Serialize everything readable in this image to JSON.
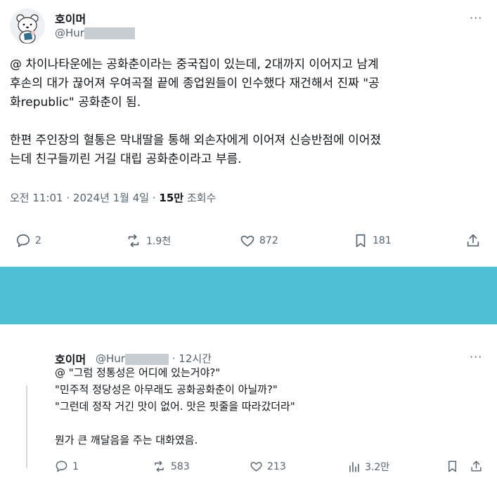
{
  "tweet1": {
    "author_name": "호이머",
    "handle_prefix": "@Hur",
    "more_label": "···",
    "text_lines": [
      "@ 차이나타운에는 공화춘이라는 중국집이 있는데, 2대까지 이어지고 남계",
      "후손의 대가 끊어져 우여곡절 끝에 종업원들이 인수했다 재건해서 진짜 \"공",
      "화republic\" 공화춘이 됨."
    ],
    "text_lines_2": [
      "한편 주인장의 혈통은 막내딸을 통해 외손자에게 이어져 신승반점에 이어졌",
      "는데 친구들끼린 거길 대립 공화춘이라고 부름."
    ],
    "meta_time": "오전 11:01 · 2024년 1월 4일 · ",
    "meta_views_count": "15만",
    "meta_views_label": " 조회수",
    "actions": {
      "replies": "2",
      "retweets": "1.9천",
      "likes": "872",
      "bookmarks": "181"
    }
  },
  "tweet2": {
    "author_name": "호이머",
    "handle_prefix": "@Hur",
    "time": "· 12시간",
    "more_label": "···",
    "text_lines": [
      "@ \"그럼 정통성은 어디에 있는거야?\"",
      "\"민주적 정당성은 아무래도 공화공화춘이 아닐까?\"",
      "\"그런데 정작 거긴 맛이 없어. 맛은 핏줄을 따라갔더라\""
    ],
    "text_last": "뭔가 큰 깨달음을 주는 대화였음.",
    "actions": {
      "replies": "1",
      "retweets": "583",
      "likes": "213",
      "views": "3.2만"
    }
  },
  "colors": {
    "divider": "#4ec0d6",
    "text": "#0f1419",
    "secondary": "#536471"
  }
}
